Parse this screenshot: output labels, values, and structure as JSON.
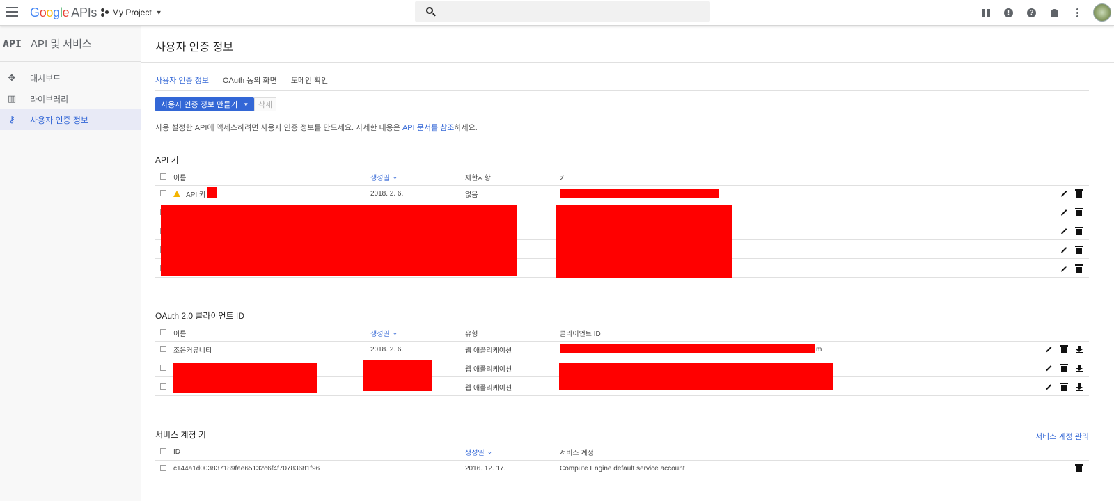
{
  "topbar": {
    "logo_letters": [
      "G",
      "o",
      "o",
      "g",
      "l",
      "e"
    ],
    "logo_suffix": "APIs",
    "project": "My Project",
    "icons": [
      "gift-icon",
      "feedback-icon",
      "help-icon",
      "notifications-icon",
      "more-vert-icon"
    ]
  },
  "sidebar": {
    "badge": "API",
    "title": "API 및 서비스",
    "items": [
      {
        "label": "대시보드",
        "icon": "dashboard-icon"
      },
      {
        "label": "라이브러리",
        "icon": "library-icon"
      },
      {
        "label": "사용자 인증 정보",
        "icon": "key-icon",
        "active": true
      }
    ]
  },
  "main": {
    "title": "사용자 인증 정보",
    "tabs": [
      "사용자 인증 정보",
      "OAuth 동의 화면",
      "도메인 확인"
    ],
    "create_button": "사용자 인증 정보 만들기",
    "delete_button": "삭제",
    "description_prefix": "사용 설정한 API에 액세스하려면 사용자 인증 정보를 만드세요. 자세한 내용은 ",
    "description_link": "API 문서를 참조",
    "description_suffix": "하세요."
  },
  "api_keys": {
    "title": "API 키",
    "headers": {
      "name": "이름",
      "created": "생성일",
      "restrictions": "제한사항",
      "key": "키"
    },
    "rows": [
      {
        "name": "API 키",
        "created": "2018. 2. 6.",
        "restrictions": "없음",
        "key": "",
        "warning": true
      },
      {
        "name": "",
        "created": "",
        "restrictions": "",
        "key": ""
      },
      {
        "name": "",
        "created": "",
        "restrictions": "",
        "key": ""
      },
      {
        "name": "",
        "created": "",
        "restrictions": "",
        "key": ""
      },
      {
        "name": "",
        "created": "",
        "restrictions": "",
        "key": ""
      }
    ]
  },
  "oauth": {
    "title": "OAuth 2.0 클라이언트 ID",
    "headers": {
      "name": "이름",
      "created": "생성일",
      "type": "유형",
      "client_id": "클라이언트 ID"
    },
    "rows": [
      {
        "name": "조은커뮤니티",
        "created": "2018. 2. 6.",
        "type": "웹 애플리케이션",
        "client_id": "m"
      },
      {
        "name": "",
        "created": "",
        "type": "웹 애플리케이션",
        "client_id": ""
      },
      {
        "name": "",
        "created": "",
        "type": "웹 애플리케이션",
        "client_id": ""
      }
    ]
  },
  "service_accounts": {
    "title": "서비스 계정 키",
    "manage_link": "서비스 계정 관리",
    "headers": {
      "id": "ID",
      "created": "생성일",
      "account": "서비스 계정"
    },
    "rows": [
      {
        "id": "c144a1d003837189fae65132c6f4f70783681f96",
        "created": "2016. 12. 17.",
        "account": "Compute Engine default service account"
      }
    ]
  },
  "colors": {
    "accent": "#3367d6",
    "redaction": "#ff0000",
    "warning": "#f4b400"
  }
}
